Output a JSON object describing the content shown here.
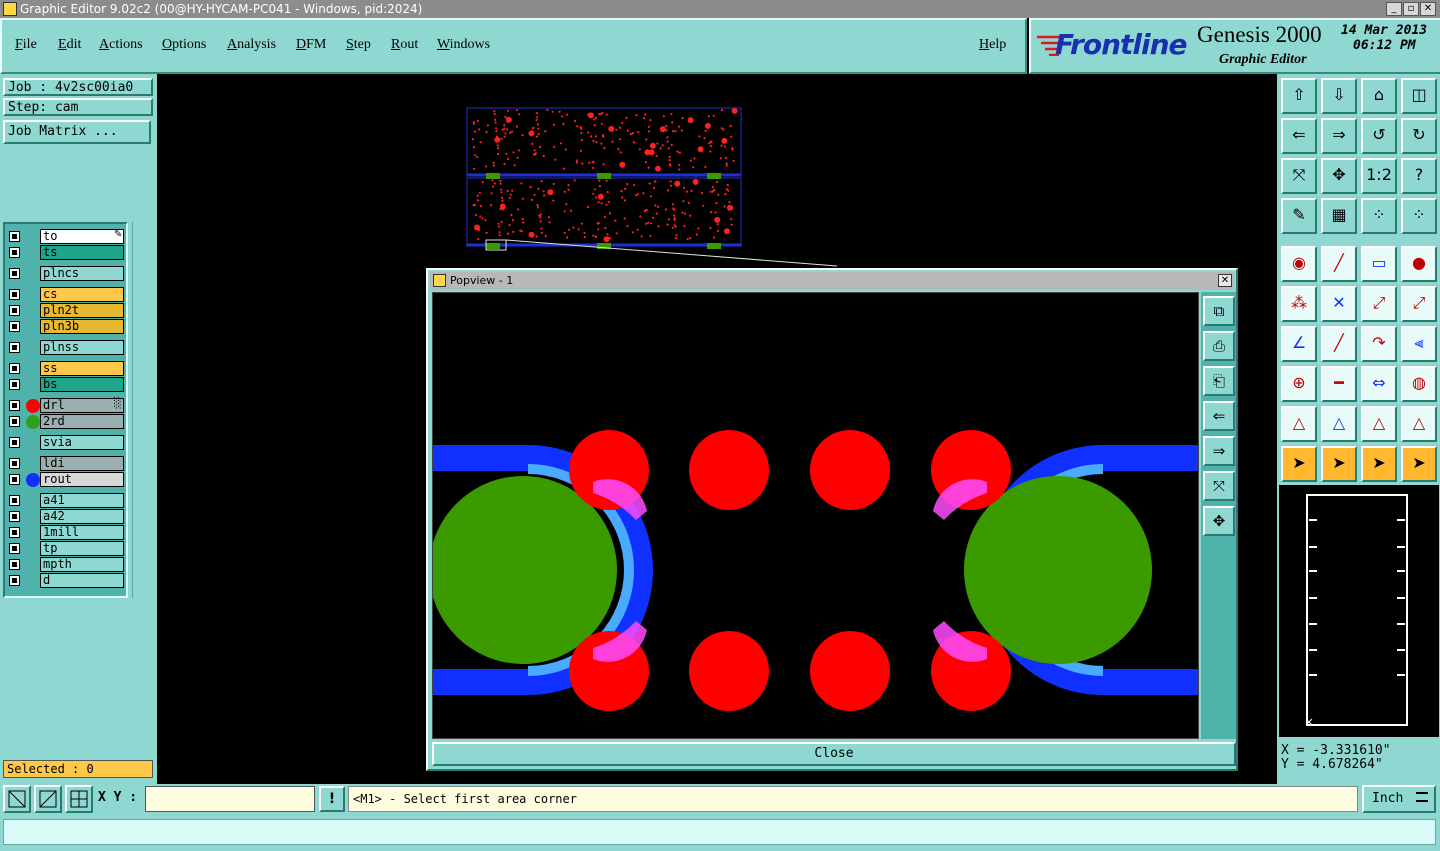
{
  "window": {
    "title": "Graphic Editor 9.02c2 (00@HY-HYCAM-PC041 - Windows, pid:2024)",
    "buttons": [
      "_",
      "▫",
      "✕"
    ]
  },
  "menubar": {
    "items": [
      "File",
      "Edit",
      "Actions",
      "Options",
      "Analysis",
      "DFM",
      "Step",
      "Rout",
      "Windows"
    ],
    "help": "Help"
  },
  "brand": {
    "logo_text": "Frontline",
    "product": "Genesis 2000",
    "subtitle": "Graphic Editor",
    "date": "14 Mar 2013",
    "time": "06:12 PM"
  },
  "job": {
    "job_label": "Job : 4v2sc00ia0",
    "step_label": "Step: cam",
    "matrix_button": "Job Matrix ..."
  },
  "layers": [
    {
      "name": "to",
      "bg": "#ffffff",
      "dot": "",
      "marker": "✎"
    },
    {
      "name": "ts",
      "bg": "#1fa58a",
      "dot": ""
    },
    {
      "name": "plncs",
      "bg": "#8fd8d2",
      "dot": ""
    },
    {
      "name": "cs",
      "bg": "#ffc84a",
      "dot": ""
    },
    {
      "name": "pln2t",
      "bg": "#e8b830",
      "dot": ""
    },
    {
      "name": "pln3b",
      "bg": "#e8b830",
      "dot": ""
    },
    {
      "name": "plnss",
      "bg": "#8fd8d2",
      "dot": ""
    },
    {
      "name": "ss",
      "bg": "#ffc84a",
      "dot": ""
    },
    {
      "name": "bs",
      "bg": "#1fa58a",
      "dot": ""
    },
    {
      "name": "drl",
      "bg": "#9ab0b0",
      "dot": "#ff0000",
      "marker": "░"
    },
    {
      "name": "2rd",
      "bg": "#9ab0b0",
      "dot": "#2fa020"
    },
    {
      "name": "svia",
      "bg": "#8fd8d2",
      "dot": ""
    },
    {
      "name": "ldi",
      "bg": "#9ab0b0",
      "dot": ""
    },
    {
      "name": "rout",
      "bg": "#d8d8d8",
      "dot": "#1030ff"
    },
    {
      "name": "a41",
      "bg": "#8fd8d2",
      "dot": ""
    },
    {
      "name": "a42",
      "bg": "#8fd8d2",
      "dot": ""
    },
    {
      "name": "1mill",
      "bg": "#8fd8d2",
      "dot": ""
    },
    {
      "name": "tp",
      "bg": "#8fd8d2",
      "dot": ""
    },
    {
      "name": "mpth",
      "bg": "#8fd8d2",
      "dot": ""
    },
    {
      "name": "d",
      "bg": "#8fd8d2",
      "dot": ""
    }
  ],
  "selected": "Selected : 0",
  "popview": {
    "title": "Popview - 1",
    "close_label": "Close"
  },
  "coords": {
    "x": "X = -3.331610\"",
    "y": "Y = 4.678264\""
  },
  "bottom": {
    "xy_label": "X Y :",
    "xy_value": "",
    "alert": "!",
    "prompt": "<M1> - Select first area corner",
    "units": "Inch"
  },
  "colors": {
    "panel": "#8fd8d2",
    "pad_red": "#ff0000",
    "pad_green": "#3a9a00",
    "rout_blue": "#1030ff",
    "ring_light": "#49aaff"
  }
}
